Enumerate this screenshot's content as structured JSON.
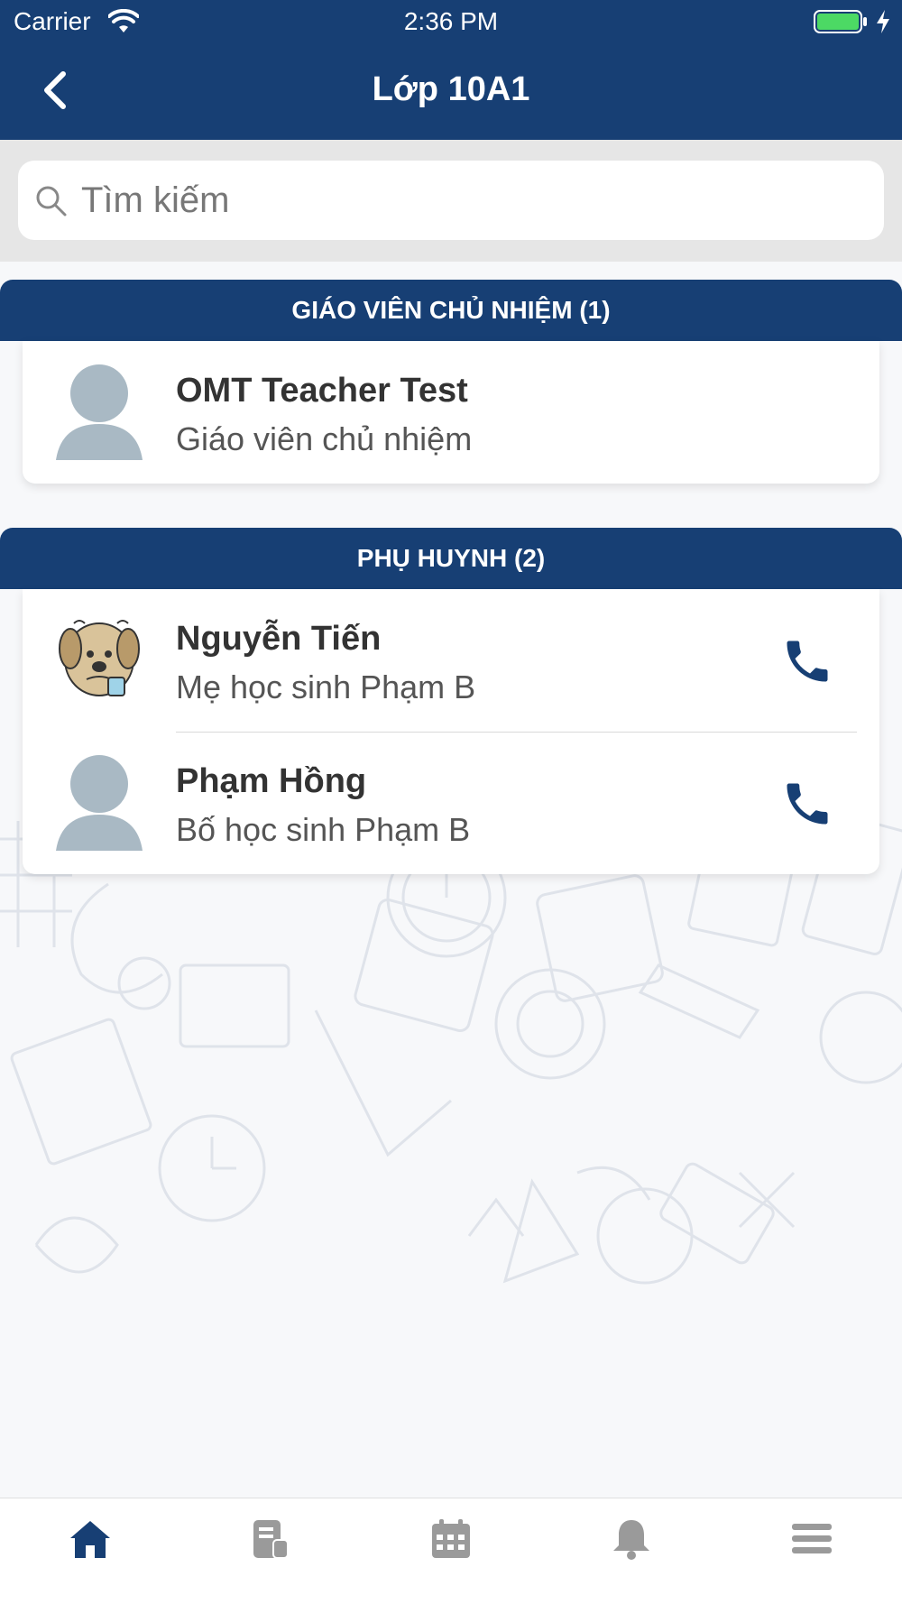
{
  "status_bar": {
    "carrier": "Carrier",
    "time": "2:36 PM"
  },
  "nav": {
    "title": "Lớp 10A1",
    "back_icon": "chevron-left-icon"
  },
  "search": {
    "placeholder": "Tìm kiếm",
    "value": ""
  },
  "sections": [
    {
      "title": "GIÁO VIÊN CHỦ NHIỆM (1)",
      "contacts": [
        {
          "name": "OMT Teacher Test",
          "role": "Giáo viên chủ nhiệm",
          "avatar": "default-avatar",
          "has_phone": false
        }
      ]
    },
    {
      "title": "PHỤ HUYNH (2)",
      "contacts": [
        {
          "name": "Nguyễn Tiến",
          "role": "Mẹ học sinh Phạm B",
          "avatar": "cartoon-dog-avatar",
          "has_phone": true
        },
        {
          "name": "Phạm Hồng",
          "role": "Bố học sinh Phạm B",
          "avatar": "default-avatar",
          "has_phone": true
        }
      ]
    }
  ],
  "tab_bar": {
    "items": [
      {
        "icon": "home-icon",
        "active": true
      },
      {
        "icon": "document-icon",
        "active": false
      },
      {
        "icon": "calendar-icon",
        "active": false
      },
      {
        "icon": "bell-icon",
        "active": false
      },
      {
        "icon": "menu-icon",
        "active": false
      }
    ]
  },
  "colors": {
    "primary": "#173f74",
    "inactive_icon": "#9a9a9a",
    "avatar_placeholder": "#a9b9c4"
  }
}
